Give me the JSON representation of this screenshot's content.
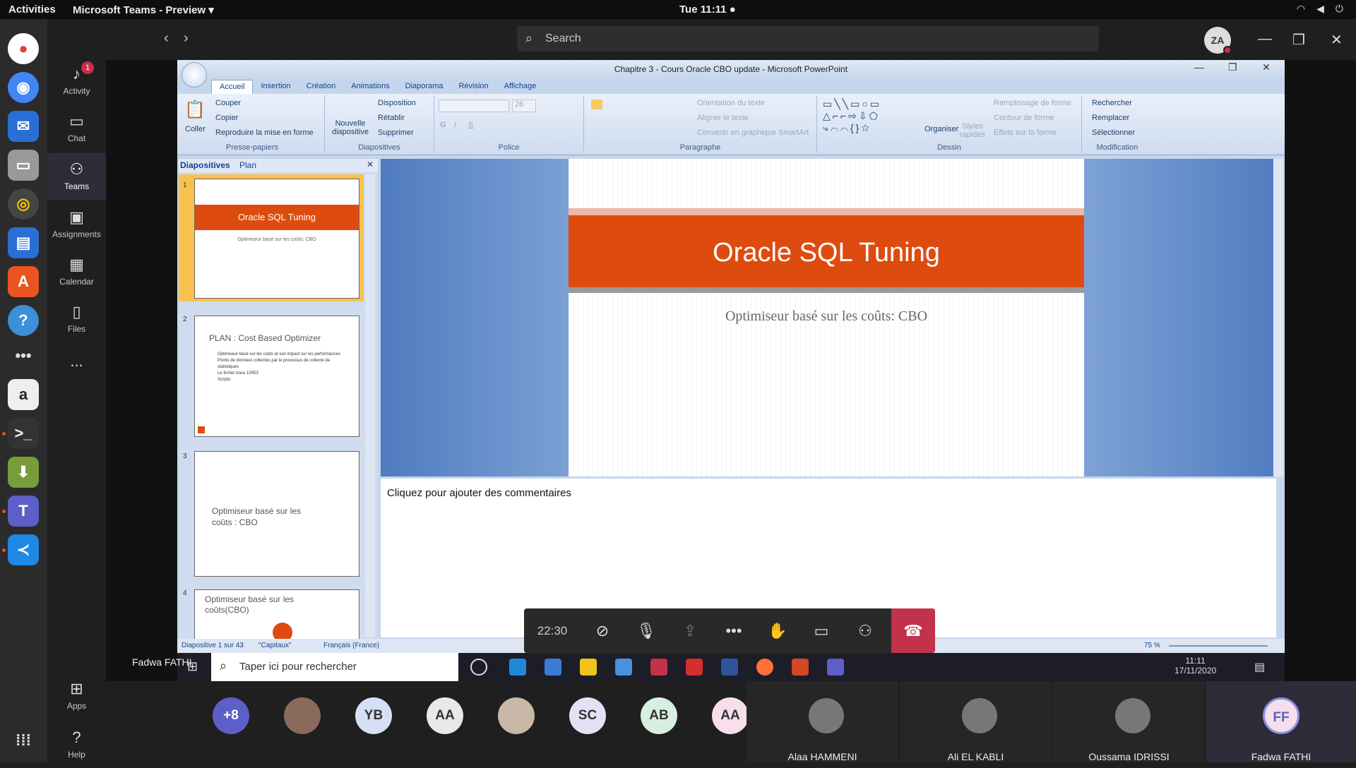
{
  "topbar": {
    "activities": "Activities",
    "app": "Microsoft Teams - Preview ▾",
    "clock": "Tue 11:11 ●"
  },
  "rail": {
    "activity": "Activity",
    "activity_badge": "1",
    "chat": "Chat",
    "teams": "Teams",
    "assignments": "Assignments",
    "calendar": "Calendar",
    "files": "Files",
    "more": "...",
    "apps": "Apps",
    "help": "Help"
  },
  "teams_header": {
    "search": "Search",
    "avatar": "ZA"
  },
  "ppt": {
    "title": "Chapitre 3 - Cours Oracle CBO update - Microsoft PowerPoint",
    "tabs": [
      "Accueil",
      "Insertion",
      "Création",
      "Animations",
      "Diaporama",
      "Révision",
      "Affichage"
    ],
    "ribbon": {
      "coller": "Coller",
      "couper": "Couper",
      "copier": "Copier",
      "reproduire": "Reproduire la mise en forme",
      "presse": "Presse-papiers",
      "nouvelle": "Nouvelle diapositive",
      "disposition": "Disposition",
      "retablir": "Rétablir",
      "supprimer": "Supprimer",
      "diapos": "Diapositives",
      "font_size": "26",
      "police": "Police",
      "orientation": "Orientation du texte",
      "aligner": "Aligner le texte",
      "convertir": "Convertir en graphique SmartArt",
      "paragraphe": "Paragraphe",
      "organiser": "Organiser",
      "styles": "Styles rapides",
      "remplissage": "Remplissage de forme",
      "contour": "Contour de forme",
      "effets": "Effets sur la forme",
      "dessin": "Dessin",
      "rechercher": "Rechercher",
      "remplacer": "Remplacer",
      "selectionner": "Sélectionner",
      "modification": "Modification"
    },
    "side_tabs": {
      "slides": "Diapositives",
      "plan": "Plan"
    },
    "thumbs": [
      {
        "num": "1",
        "title": "Oracle SQL Tuning",
        "sub": "Optimiseur basé sur les coûts: CBO"
      },
      {
        "num": "2",
        "title": "PLAN : Cost Based Optimizer",
        "bullets": [
          "Optimiseur basé sur les coûts et son impact sur les performances",
          "Points de données collectés par le processus de collecte de statistiques",
          "Le fichier trace 10053",
          "Scripts"
        ]
      },
      {
        "num": "3",
        "title": "Optimiseur basé sur les coûts : CBO"
      },
      {
        "num": "4",
        "title": "Optimiseur basé sur les coûts(CBO)"
      }
    ],
    "slide": {
      "title": "Oracle SQL Tuning",
      "subtitle": "Optimiseur basé sur les coûts: CBO"
    },
    "notes": "Cliquez pour ajouter des commentaires",
    "status": {
      "slide": "Diapositive 1 sur 43",
      "theme": "\"Capitaux\"",
      "lang": "Français (France)",
      "zoom": "75 %"
    }
  },
  "windows": {
    "search": "Taper ici pour rechercher",
    "time": "11:11",
    "date": "17/11/2020"
  },
  "call": {
    "timer": "22:30",
    "presenter": "Fadwa FATHI"
  },
  "participants": {
    "avatars": [
      {
        "i": "+8",
        "bg": "#5b5fc7",
        "fg": "#fff"
      },
      {
        "i": "",
        "bg": "#8a6a5a",
        "fg": "#fff"
      },
      {
        "i": "YB",
        "bg": "#d5dff5",
        "fg": "#333"
      },
      {
        "i": "AA",
        "bg": "#e8e8e8",
        "fg": "#333"
      },
      {
        "i": "",
        "bg": "#c9b7a7",
        "fg": "#fff"
      },
      {
        "i": "SC",
        "bg": "#e5e1f5",
        "fg": "#333"
      },
      {
        "i": "AB",
        "bg": "#d7efe0",
        "fg": "#333"
      },
      {
        "i": "AA",
        "bg": "#f6dfea",
        "fg": "#333"
      }
    ],
    "tiles": [
      "Alaa HAMMENI",
      "Ali EL KABLI",
      "Oussama IDRISSI"
    ],
    "self": "Fadwa FATHI",
    "self_initials": "FF"
  }
}
